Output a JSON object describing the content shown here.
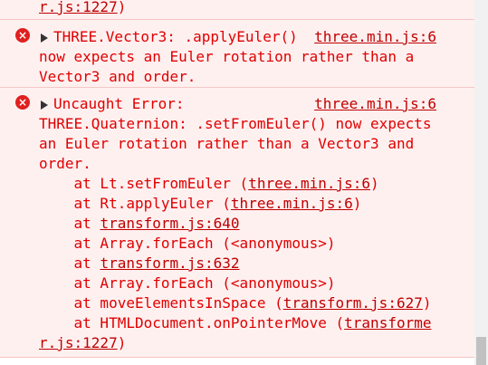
{
  "console": {
    "top_partial": {
      "text": "r.js:1227",
      "suffix": ")"
    },
    "warning1": {
      "title": "THREE.Vector3: .applyEuler()",
      "source": "three.min.js:6",
      "line2": "now expects an Euler rotation rather than a",
      "line3": "Vector3 and order."
    },
    "error": {
      "title": "Uncaught Error:",
      "source": "three.min.js:6",
      "line2": "THREE.Quaternion: .setFromEuler() now expects",
      "line3": "an Euler rotation rather than a Vector3 and",
      "line4": "order.",
      "stack": [
        {
          "prefix": "    at Lt.setFromEuler (",
          "link": "three.min.js:6",
          "suffix": ")"
        },
        {
          "prefix": "    at Rt.applyEuler (",
          "link": "three.min.js:6",
          "suffix": ")"
        },
        {
          "prefix": "    at ",
          "link": "transform.js:640",
          "suffix": ""
        },
        {
          "prefix": "    at Array.forEach (<anonymous>)",
          "link": "",
          "suffix": ""
        },
        {
          "prefix": "    at ",
          "link": "transform.js:632",
          "suffix": ""
        },
        {
          "prefix": "    at Array.forEach (<anonymous>)",
          "link": "",
          "suffix": ""
        },
        {
          "prefix": "    at moveElementsInSpace (",
          "link": "transform.js:627",
          "suffix": ")"
        },
        {
          "prefix": "    at HTMLDocument.onPointerMove (",
          "link": "transforme",
          "suffix": ""
        }
      ],
      "last_line_link": "r.js:1227",
      "last_line_suffix": ")"
    },
    "icons": {
      "error": "error-circle-icon",
      "expand": "expand-triangle-icon"
    },
    "colors": {
      "error_text": "#e00000",
      "error_bg": "#fff0f0",
      "error_icon": "#e02020"
    }
  }
}
